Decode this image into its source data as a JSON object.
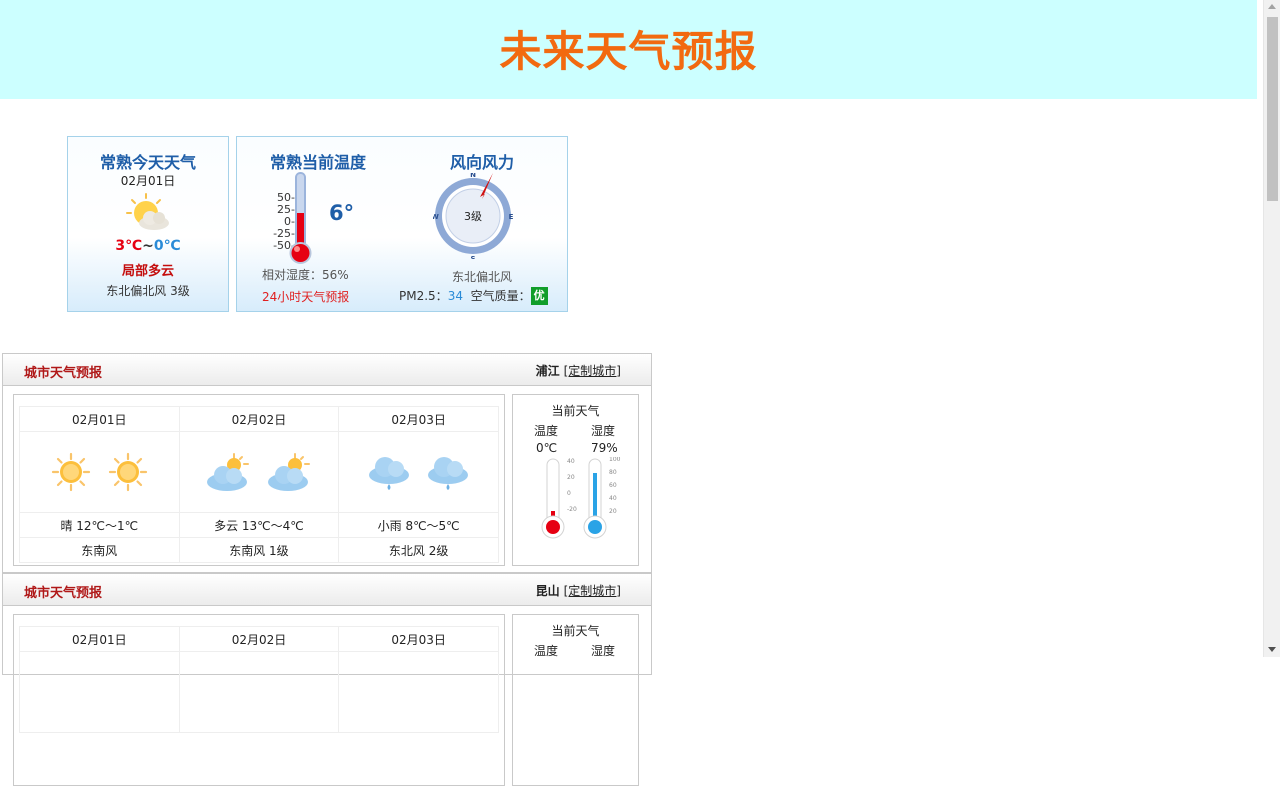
{
  "header": {
    "title": "未来天气预报"
  },
  "today": {
    "title": "常熟今天天气",
    "date": "02月01日",
    "temp_high": "3℃",
    "temp_sep": "~",
    "temp_low": "0℃",
    "condition": "局部多云",
    "wind": "东北偏北风 3级",
    "icon": "partly-cloudy-sun-icon"
  },
  "current": {
    "title": "常熟当前温度",
    "temperature": "6°",
    "scale": [
      "50-",
      "25-",
      "0-",
      "-25-",
      "-50-"
    ],
    "humidity": "相对湿度：56%",
    "forecast_24h_link": "24小时天气预报",
    "wind_title": "风向风力",
    "wind_level": "3级",
    "compass_n": "N",
    "compass_s": "S",
    "compass_e": "E",
    "compass_w": "W",
    "wind_direction": "东北偏北风",
    "pm25_label": "PM2.5：",
    "pm25_value": "34",
    "aq_label": "空气质量：",
    "aq_value": "优",
    "colors": {
      "title": "#1f5ea8",
      "mercury": "#e60012",
      "aq_good": "#119e2a"
    }
  },
  "cities": [
    {
      "section_title": "城市天气预报",
      "city": "浦江",
      "customize_link": "[定制城市]",
      "days": [
        {
          "date": "02月01日",
          "icon": "sun-icon",
          "desc": "晴 12℃～1℃",
          "wind": "东南风"
        },
        {
          "date": "02月02日",
          "icon": "cloud-sun-icon",
          "desc": "多云 13℃～4℃",
          "wind": "东南风 1级"
        },
        {
          "date": "02月03日",
          "icon": "rain-cloud-icon",
          "desc": "小雨 8℃～5℃",
          "wind": "东北风 2级"
        }
      ],
      "current": {
        "title": "当前天气",
        "temp_label": "温度",
        "hum_label": "湿度",
        "temp_value": "0℃",
        "hum_value": "79%",
        "temp_ticks": [
          "40",
          "20",
          "0",
          "-20"
        ],
        "hum_ticks": [
          "100",
          "80",
          "60",
          "40",
          "20"
        ]
      }
    },
    {
      "section_title": "城市天气预报",
      "city": "昆山",
      "customize_link": "[定制城市]",
      "days": [
        {
          "date": "02月01日"
        },
        {
          "date": "02月02日"
        },
        {
          "date": "02月03日"
        }
      ],
      "current": {
        "title": "当前天气",
        "temp_label": "温度",
        "hum_label": "湿度"
      }
    }
  ]
}
